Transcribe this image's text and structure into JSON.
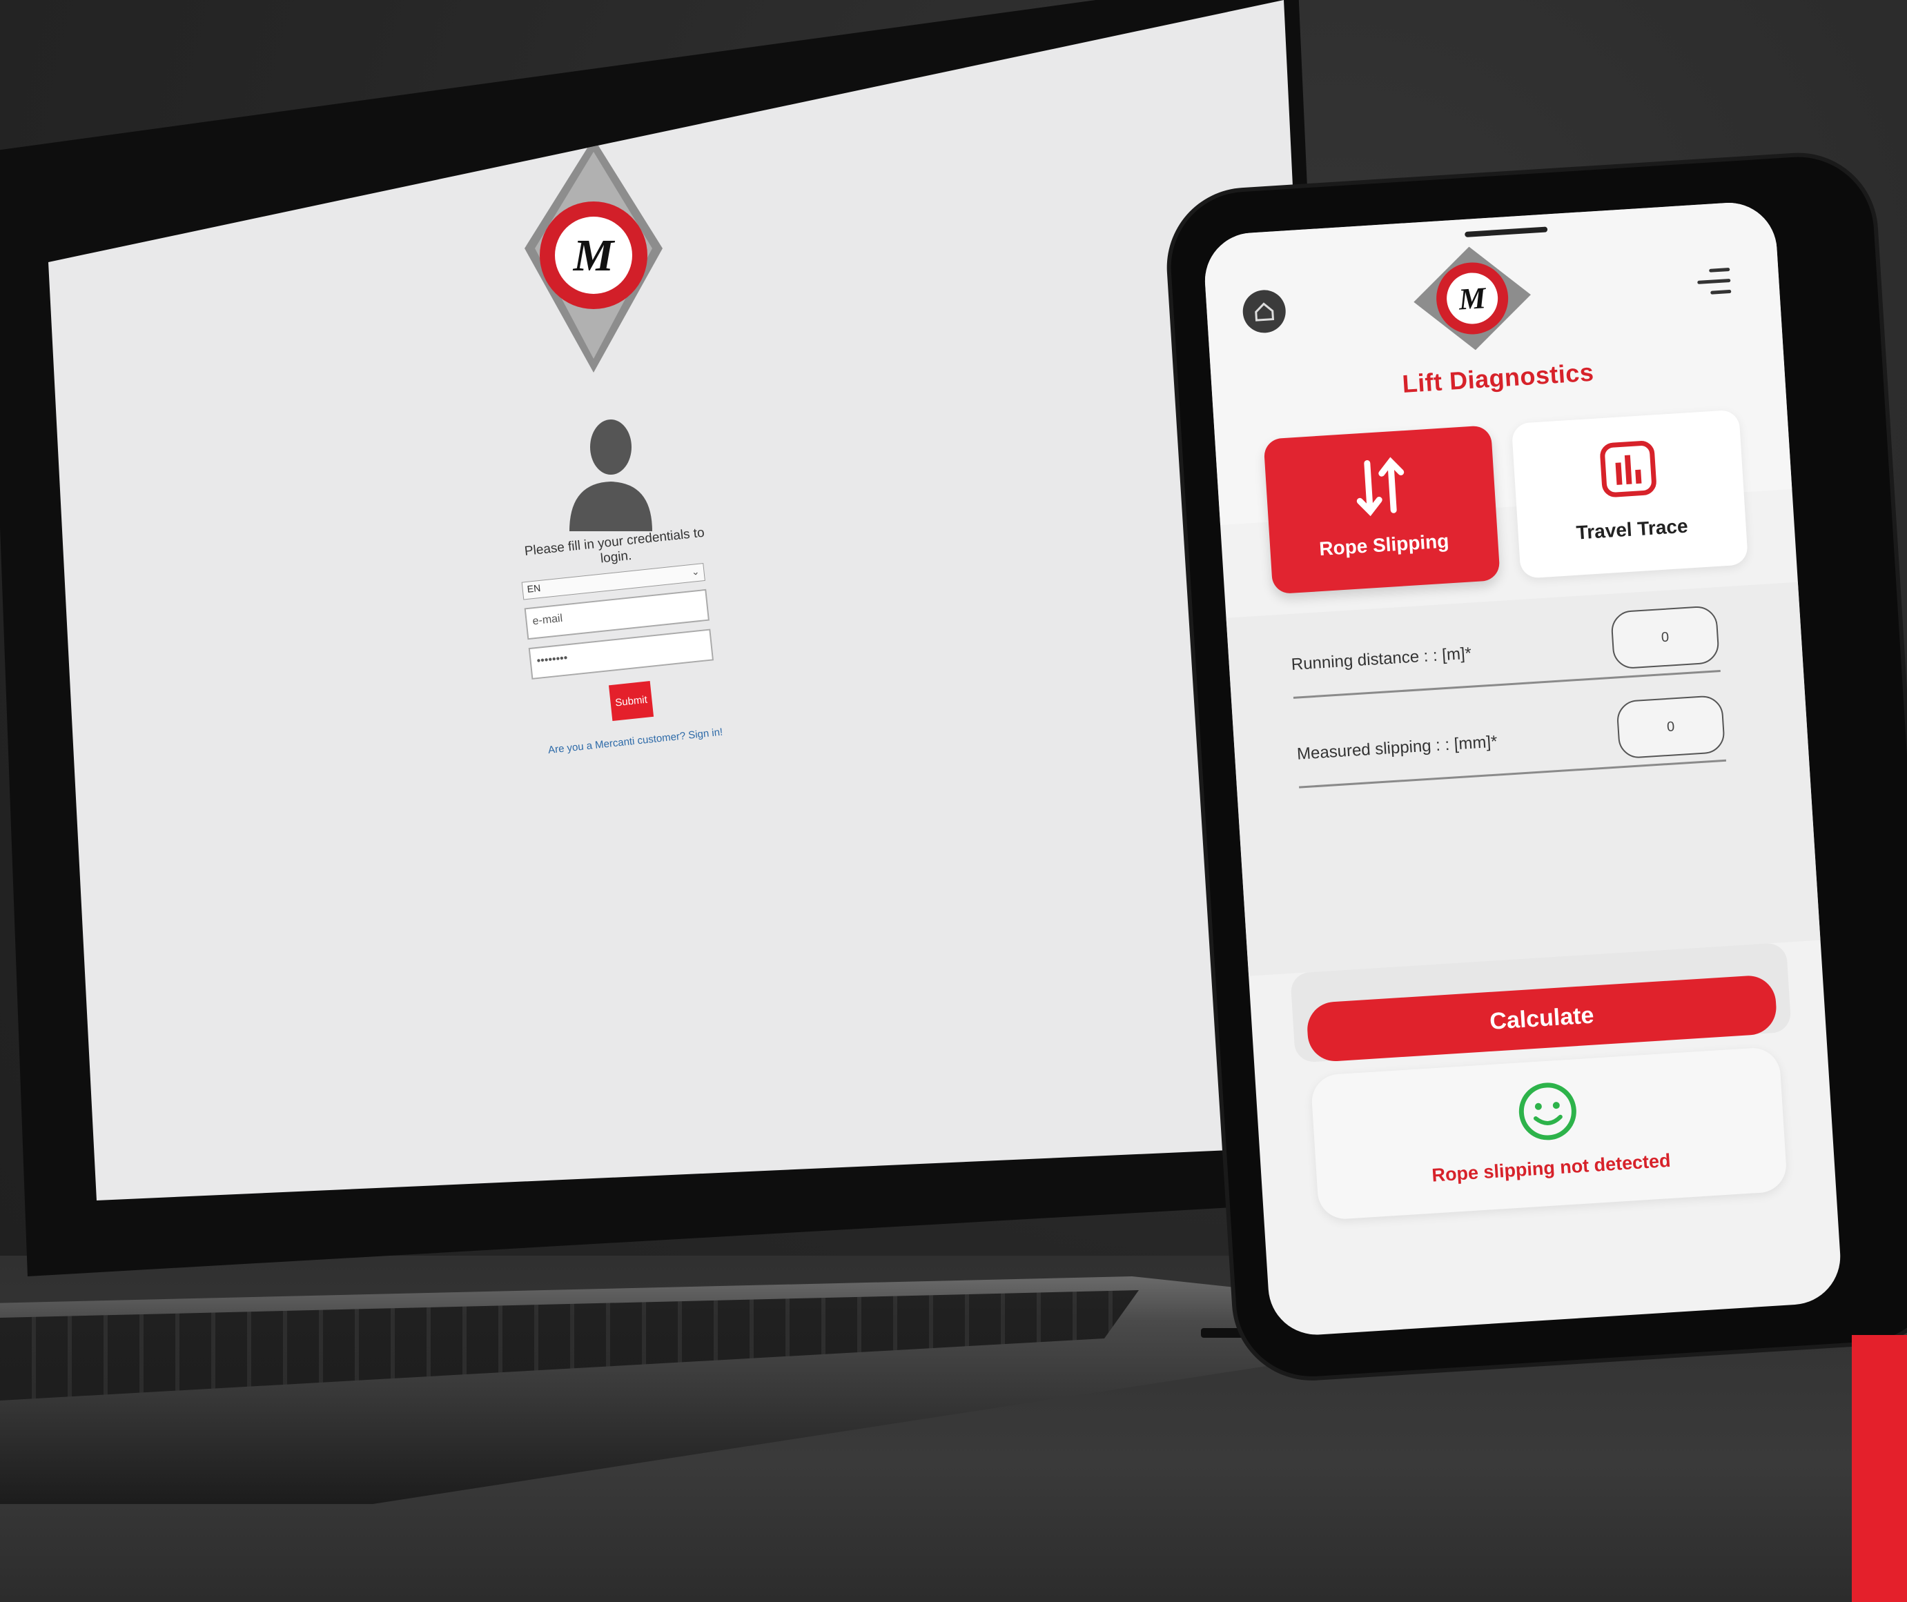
{
  "colors": {
    "brand_red": "#e12430",
    "background": "#2a2a2a",
    "success_green": "#2db34a",
    "link_blue": "#2d6aa8"
  },
  "laptop": {
    "logo_letter": "M",
    "prompt": "Please fill in your credentials to login.",
    "language_value": "EN",
    "email_placeholder": "e-mail",
    "password_value": "••••••••",
    "submit_label": "Submit",
    "signin_link": "Are you a Mercanti customer? Sign in!"
  },
  "phone": {
    "logo_letter": "M",
    "title": "Lift Diagnostics",
    "tiles": [
      {
        "label": "Rope Slipping",
        "icon": "up-down-arrows-icon"
      },
      {
        "label": "Travel Trace",
        "icon": "bar-chart-icon"
      }
    ],
    "fields": [
      {
        "label": "Running distance : : [m]*",
        "value": "0"
      },
      {
        "label": "Measured slipping : : [mm]*",
        "value": "0"
      }
    ],
    "calculate_label": "Calculate",
    "result_text": "Rope slipping not detected"
  }
}
